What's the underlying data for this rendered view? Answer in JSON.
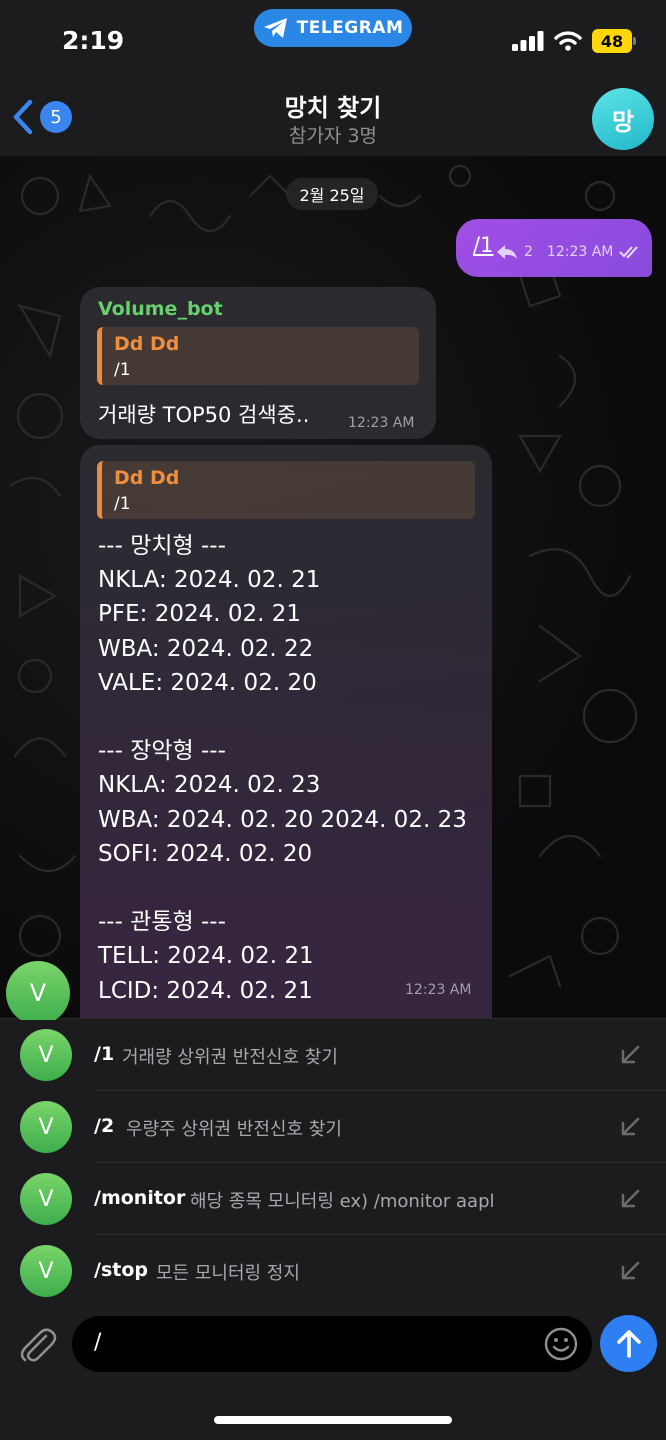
{
  "status": {
    "time": "2:19",
    "app_pill": "TELEGRAM",
    "battery": "48"
  },
  "header": {
    "back_count": "5",
    "title": "망치 찾기",
    "subtitle": "참가자 3명",
    "avatar_letter": "망"
  },
  "chat": {
    "date_chip": "2월 25일",
    "outgoing": {
      "text": "/1",
      "replies": "2",
      "time": "12:23 AM"
    },
    "msg1": {
      "sender": "Volume_bot",
      "reply_name": "Dd Dd",
      "reply_text": "/1",
      "text": "거래량 TOP50 검색중..",
      "time": "12:23 AM"
    },
    "msg2": {
      "reply_name": "Dd Dd",
      "reply_text": "/1",
      "body": "--- 망치형 ---\nNKLA: 2024. 02. 21\nPFE: 2024. 02. 21\nWBA: 2024. 02. 22\nVALE: 2024. 02. 20\n\n--- 장악형 ---\nNKLA: 2024. 02. 23\nWBA: 2024. 02. 20 2024. 02. 23\nSOFI: 2024. 02. 20\n\n--- 관통형 ---\nTELL: 2024. 02. 21\nLCID: 2024. 02. 21",
      "time": "12:23 AM"
    },
    "sender_avatar_letter": "V"
  },
  "commands": [
    {
      "avatar": "V",
      "name": "/1",
      "desc": "거래량 상위권 반전신호 찾기"
    },
    {
      "avatar": "V",
      "name": "/2",
      "desc": "우량주 상위권 반전신호 찾기"
    },
    {
      "avatar": "V",
      "name": "/monitor",
      "desc": "해당 종목 모니터링 ex) /monitor aapl"
    },
    {
      "avatar": "V",
      "name": "/stop",
      "desc": "모든 모니터링 정지"
    }
  ],
  "input": {
    "value": "/"
  },
  "colors": {
    "accent": "#2d7ff2",
    "outgoing_bubble": "#9a4ee4",
    "bot_name": "#67d06c",
    "reply_accent": "#ee8b3a"
  }
}
